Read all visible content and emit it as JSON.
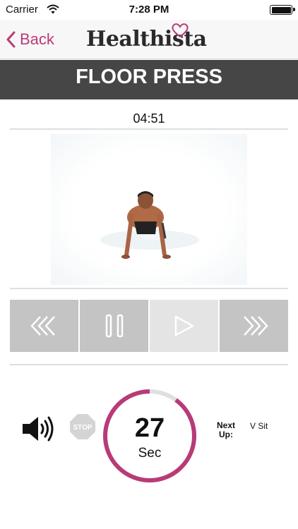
{
  "status_bar": {
    "carrier": "Carrier",
    "time": "7:28 PM"
  },
  "nav": {
    "back_label": "Back",
    "logo_text": "Healthista"
  },
  "exercise": {
    "title": "FLOOR PRESS",
    "elapsed": "04:51"
  },
  "countdown": {
    "value": "27",
    "unit": "Sec",
    "progress_fraction": 0.9
  },
  "controls": [
    "rewind",
    "pause",
    "play",
    "fast-forward"
  ],
  "next": {
    "label": "Next Up:",
    "value": "V Sit"
  },
  "colors": {
    "accent": "#b83b78",
    "title_bar": "#464646",
    "control_bg": "#c4c4c4",
    "control_active": "#e4e4e4"
  }
}
